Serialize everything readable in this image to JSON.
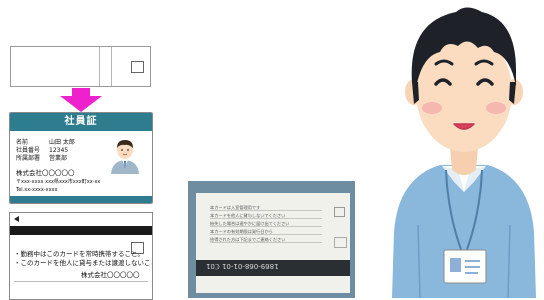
{
  "id_card": {
    "title": "社員証",
    "name_label": "名前",
    "name_value": "山田 太郎",
    "number_label": "社員番号",
    "number_value": "12345",
    "dept_label": "所属部署",
    "dept_value": "営業部",
    "company": "株式会社〇〇〇〇〇",
    "address": "〒xxx-xxxx xxx県xxx市xxx町xx-xx",
    "tel": "Tel.xx-xxxx-xxxx"
  },
  "back_card": {
    "line1": "・勤務中はこのカードを常時携帯すること。",
    "line2": "・このカードを他人に貸与または譲渡しないこと。",
    "company": "株式会社〇〇〇〇〇"
  },
  "photo_card": {
    "mirror_text": "1869-068-01-01  ℂ01",
    "lines": [
      "本カードは入室管理用です",
      "本カードを他人に貸与しないでください",
      "紛失した場合は速やかに届け出てください",
      "本カードの有効期限は発行日から",
      "拾得された方は下記までご連絡ください"
    ]
  },
  "colors": {
    "card_teal": "#2e7d8e",
    "arrow_magenta": "#ee22cc",
    "shirt_blue": "#8ab7dc",
    "skin": "#fbdcc0"
  }
}
